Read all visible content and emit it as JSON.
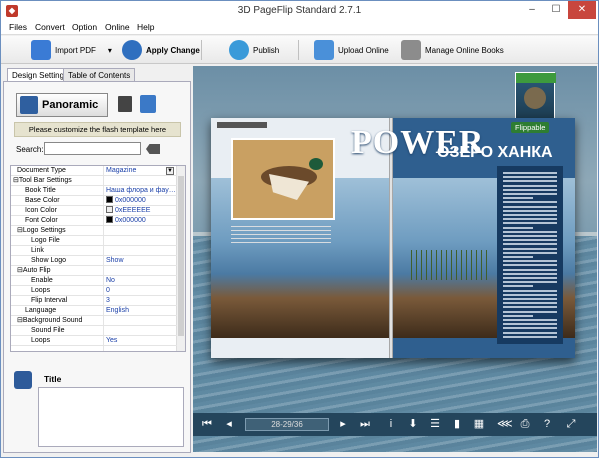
{
  "window": {
    "title": "3D PageFlip Standard 2.7.1",
    "minimize": "–",
    "maximize": "☐",
    "close": "✕"
  },
  "menu": [
    "Files",
    "Convert",
    "Option",
    "Online",
    "Help"
  ],
  "toolbar": {
    "import_pdf": "Import PDF",
    "import_pdf_arrow": "▾",
    "apply_change": "Apply Change",
    "publish": "Publish",
    "upload_online": "Upload Online",
    "manage_online_books": "Manage Online Books"
  },
  "tabs": [
    "Design Setting",
    "Table of Contents"
  ],
  "panel": {
    "panoramic_label": "Panoramic",
    "customize_text": "Please customize the flash template here",
    "search_label": "Search:",
    "search_value": ""
  },
  "settings": [
    {
      "name": "Document Type",
      "value": "Magazine",
      "indent": 1,
      "dropdown": true
    },
    {
      "name": "⊟Tool Bar Settings",
      "value": "",
      "indent": 0
    },
    {
      "name": "Book Title",
      "value": "Наша флора и фау…",
      "indent": 2
    },
    {
      "name": "Base Color",
      "value": "0x000000",
      "indent": 2,
      "swatch": "#000000"
    },
    {
      "name": "Icon Color",
      "value": "0xEEEEEE",
      "indent": 2,
      "swatch": "#EEEEEE"
    },
    {
      "name": "Font Color",
      "value": "0x000000",
      "indent": 2,
      "swatch": "#000000"
    },
    {
      "name": "⊟Logo Settings",
      "value": "",
      "indent": 1
    },
    {
      "name": "Logo File",
      "value": "",
      "indent": 3
    },
    {
      "name": "Link",
      "value": "",
      "indent": 3
    },
    {
      "name": "Show Logo",
      "value": "Show",
      "indent": 3
    },
    {
      "name": "⊟Auto Flip",
      "value": "",
      "indent": 1
    },
    {
      "name": "Enable",
      "value": "No",
      "indent": 3
    },
    {
      "name": "Loops",
      "value": "0",
      "indent": 3
    },
    {
      "name": "Flip Interval",
      "value": "3",
      "indent": 3
    },
    {
      "name": "Language",
      "value": "English",
      "indent": 2
    },
    {
      "name": "⊟Background Sound",
      "value": "",
      "indent": 1
    },
    {
      "name": "Sound File",
      "value": "",
      "indent": 3
    },
    {
      "name": "Loops",
      "value": "Yes",
      "indent": 3
    }
  ],
  "description": {
    "title": "Title",
    "body": ""
  },
  "preview": {
    "title_en": "POWER",
    "title_ru": "ОЗЕРО ХАНКА",
    "flippable_badge": "Flippable",
    "page_indicator": "28-29/36"
  },
  "colors": {
    "close_button": "#c8463d",
    "bottom_bar": "#24455c",
    "link_value": "#1a3fa8",
    "accent_green": "#2e7d32"
  },
  "bottom_bar_icons": [
    {
      "name": "first-page-icon",
      "glyph": "⏮"
    },
    {
      "name": "prev-page-icon",
      "glyph": "◂"
    },
    {
      "name": "next-page-icon",
      "glyph": "▸"
    },
    {
      "name": "last-page-icon",
      "glyph": "⏭"
    },
    {
      "name": "info-icon",
      "glyph": "i"
    },
    {
      "name": "download-icon",
      "glyph": "⬇"
    },
    {
      "name": "toc-icon",
      "glyph": "☰"
    },
    {
      "name": "bookmark-icon",
      "glyph": "▮"
    },
    {
      "name": "thumbnails-icon",
      "glyph": "▦"
    },
    {
      "name": "share-icon",
      "glyph": "⋘"
    },
    {
      "name": "print-icon",
      "glyph": "⎙"
    },
    {
      "name": "help-icon",
      "glyph": "?"
    },
    {
      "name": "fullscreen-icon",
      "glyph": "⤢"
    }
  ]
}
